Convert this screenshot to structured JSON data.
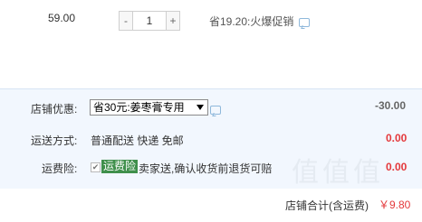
{
  "item": {
    "price": "59.00",
    "qty_minus": "-",
    "qty_value": "1",
    "qty_plus": "+",
    "promo_text": "省19.20:火爆促销"
  },
  "discount": {
    "label": "店铺优惠:",
    "selected": "省30元:姜枣膏专用",
    "amount": "-30.00"
  },
  "shipping": {
    "label": "运送方式:",
    "method": "普通配送 快递 免邮",
    "amount": "0.00"
  },
  "insurance": {
    "label": "运费险:",
    "checkbox_mark": "✔",
    "tag": "运费险",
    "text": "卖家送,确认收货前退货可赔",
    "amount": "0.00"
  },
  "total": {
    "label": "店铺合计(含运费)",
    "amount": "￥9.80"
  },
  "watermark": "值值值",
  "colors": {
    "panel_bg": "#f2f7fe",
    "red": "#e4393c",
    "green_tag": "#3f8f4b",
    "note_icon": "#8fb8db"
  },
  "icons": [
    "note-icon",
    "note-icon",
    "dropdown-arrow-icon"
  ]
}
